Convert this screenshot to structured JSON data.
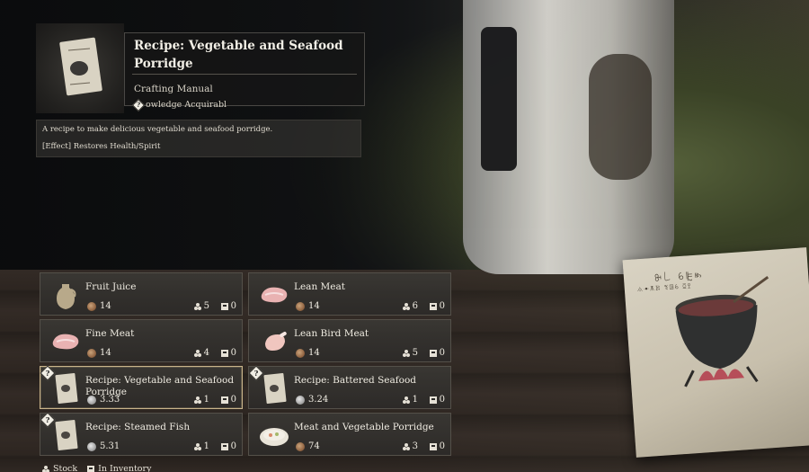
{
  "detail": {
    "title": "Recipe: Vegetable and Seafood Porridge",
    "type": "Crafting Manual",
    "knowledge": "owledge Acquirabl",
    "knowledge_icon": "?",
    "description": "A recipe to make delicious vegetable and seafood porridge.",
    "effect": "[Effect] Restores Health/Spirit"
  },
  "items": [
    {
      "name": "Fruit Juice",
      "icon": "jug-icon",
      "price": "14",
      "currency": "copper",
      "stock": "5",
      "inventory": "0",
      "selected": false,
      "new": false
    },
    {
      "name": "Lean Meat",
      "icon": "meat-icon",
      "price": "14",
      "currency": "copper",
      "stock": "6",
      "inventory": "0",
      "selected": false,
      "new": false
    },
    {
      "name": "Fine Meat",
      "icon": "meat-icon",
      "price": "14",
      "currency": "copper",
      "stock": "4",
      "inventory": "0",
      "selected": false,
      "new": false
    },
    {
      "name": "Lean Bird Meat",
      "icon": "bird-meat-icon",
      "price": "14",
      "currency": "copper",
      "stock": "5",
      "inventory": "0",
      "selected": false,
      "new": false
    },
    {
      "name": "Recipe: Vegetable and Seafood Porridge",
      "icon": "recipe-icon",
      "price": "3.33",
      "currency": "silver",
      "stock": "1",
      "inventory": "0",
      "selected": true,
      "new": true
    },
    {
      "name": "Recipe: Battered Seafood",
      "icon": "recipe-icon",
      "price": "3.24",
      "currency": "silver",
      "stock": "1",
      "inventory": "0",
      "selected": false,
      "new": true
    },
    {
      "name": "Recipe: Steamed Fish",
      "icon": "recipe-icon",
      "price": "5.31",
      "currency": "silver",
      "stock": "1",
      "inventory": "0",
      "selected": false,
      "new": true
    },
    {
      "name": "Meat and Vegetable Porridge",
      "icon": "porridge-icon",
      "price": "74",
      "currency": "copper",
      "stock": "3",
      "inventory": "0",
      "selected": false,
      "new": false
    }
  ],
  "legend": {
    "stock_label": "Stock",
    "inventory_label": "In Inventory"
  },
  "new_mark_glyph": "?",
  "colors": {
    "selected_border": "#c9b48a",
    "panel_border": "#545049"
  }
}
